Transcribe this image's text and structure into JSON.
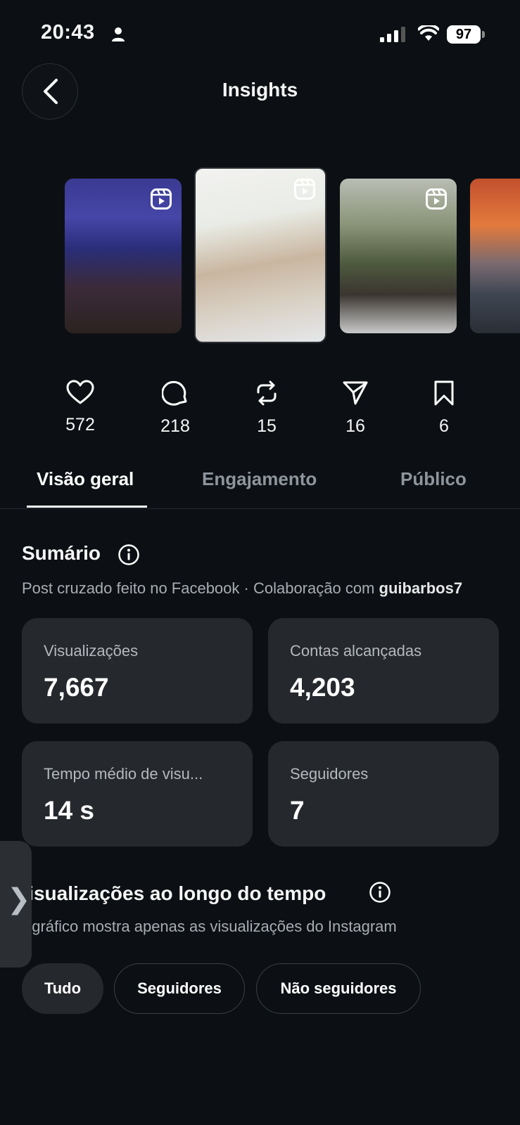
{
  "status_bar": {
    "time": "20:43",
    "battery": "97"
  },
  "header": {
    "title": "Insights"
  },
  "thumbnails": [
    {
      "icon": "reel-icon"
    },
    {
      "icon": "reel-icon"
    },
    {
      "icon": "reel-icon"
    },
    {
      "icon": "reel-icon"
    }
  ],
  "stats": [
    {
      "icon": "heart-icon",
      "value": "572"
    },
    {
      "icon": "comment-icon",
      "value": "218"
    },
    {
      "icon": "repost-icon",
      "value": "15"
    },
    {
      "icon": "send-icon",
      "value": "16"
    },
    {
      "icon": "bookmark-icon",
      "value": "6"
    }
  ],
  "tabs": [
    {
      "label": "Visão geral",
      "active": true
    },
    {
      "label": "Engajamento",
      "active": false
    },
    {
      "label": "Público",
      "active": false
    }
  ],
  "summary": {
    "title": "Sumário",
    "subtitle_prefix": "Post cruzado feito no Facebook · Colaboração com ",
    "collaborator": "guibarbos7",
    "cards": [
      {
        "label": "Visualizações",
        "value": "7,667"
      },
      {
        "label": "Contas alcançadas",
        "value": "4,203"
      },
      {
        "label": "Tempo médio de visu...",
        "value": "14 s"
      },
      {
        "label": "Seguidores",
        "value": "7"
      }
    ]
  },
  "views_over_time": {
    "title": "Visualizações ao longo do tempo",
    "subtitle": "O gráfico mostra apenas as visualizações do Instagram",
    "filters": [
      {
        "label": "Tudo",
        "active": true
      },
      {
        "label": "Seguidores",
        "active": false
      },
      {
        "label": "Não seguidores",
        "active": false
      }
    ]
  },
  "side_handle": {
    "glyph": "❯"
  }
}
